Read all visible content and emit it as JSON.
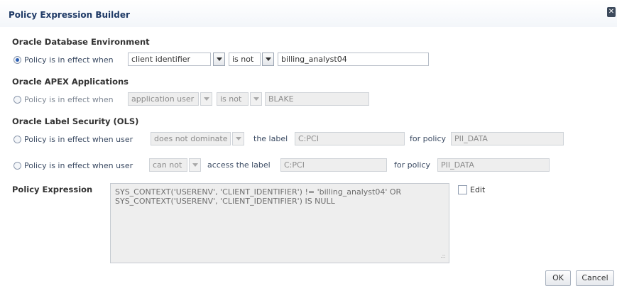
{
  "dialog": {
    "title": "Policy Expression Builder",
    "close_icon": "close-icon"
  },
  "db_env": {
    "heading": "Oracle Database Environment",
    "radio_label": "Policy is in effect when",
    "attribute": "client identifier",
    "operator": "is not",
    "value": "billing_analyst04"
  },
  "apex": {
    "heading": "Oracle APEX Applications",
    "radio_label": "Policy is in effect when",
    "attribute": "application user",
    "operator": "is not",
    "value": "BLAKE"
  },
  "ols": {
    "heading": "Oracle Label Security (OLS)",
    "row1": {
      "radio_label": "Policy is in effect when user",
      "relation": "does not dominate",
      "label_text": "the label",
      "label_value": "C:PCI",
      "policy_text": "for policy",
      "policy_value": "PII_DATA"
    },
    "row2": {
      "radio_label": "Policy is in effect when user",
      "relation": "can not",
      "label_text": "access the label",
      "label_value": "C:PCI",
      "policy_text": "for policy",
      "policy_value": "PII_DATA"
    }
  },
  "expression": {
    "heading": "Policy Expression",
    "line1": "SYS_CONTEXT('USERENV', 'CLIENT_IDENTIFIER') != 'billing_analyst04' OR",
    "line2": "SYS_CONTEXT('USERENV', 'CLIENT_IDENTIFIER') IS NULL",
    "edit_label": "Edit"
  },
  "buttons": {
    "ok": "OK",
    "cancel": "Cancel"
  }
}
